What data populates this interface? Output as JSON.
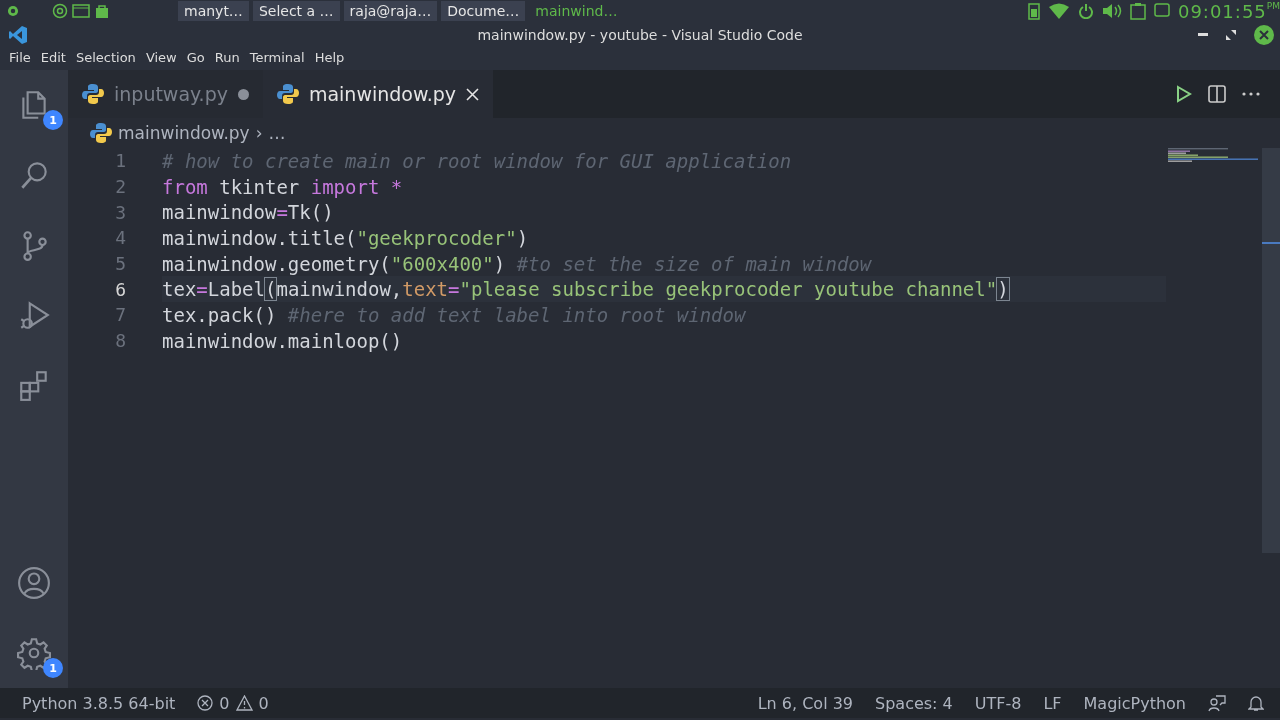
{
  "system_panel": {
    "tasks": [
      {
        "label": "manyt…",
        "selected": false
      },
      {
        "label": "Select a …",
        "selected": false
      },
      {
        "label": "raja@raja…",
        "selected": false
      },
      {
        "label": "Docume…",
        "selected": false
      },
      {
        "label": "mainwind…",
        "selected": true
      }
    ],
    "clock": "09:01:55",
    "clock_suffix": "PM"
  },
  "window": {
    "title": "mainwindow.py - youtube - Visual Studio Code"
  },
  "menu": [
    "File",
    "Edit",
    "Selection",
    "View",
    "Go",
    "Run",
    "Terminal",
    "Help"
  ],
  "activity_bar": [
    {
      "kind": "files",
      "badge": "1",
      "selected": false
    },
    {
      "kind": "search",
      "selected": false
    },
    {
      "kind": "branch",
      "selected": false
    },
    {
      "kind": "debug",
      "selected": false
    },
    {
      "kind": "extensions",
      "selected": false
    }
  ],
  "activity_bottom": [
    {
      "kind": "account"
    },
    {
      "kind": "settings",
      "badge": "1"
    }
  ],
  "tabs": [
    {
      "label": "inputway.py",
      "selected": false,
      "modified": true
    },
    {
      "label": "mainwindow.py",
      "selected": true,
      "modified": false
    }
  ],
  "breadcrumb": {
    "file": "mainwindow.py",
    "separator": "›",
    "rest": "…"
  },
  "code": [
    {
      "number": "1",
      "current": false,
      "tokens": [
        {
          "kind": "comment",
          "text": "# how to create main or root window for GUI application"
        }
      ]
    },
    {
      "number": "2",
      "current": false,
      "tokens": [
        {
          "kind": "keyword",
          "text": "from"
        },
        {
          "kind": "plain",
          "text": " tkinter "
        },
        {
          "kind": "keyword",
          "text": "import"
        },
        {
          "kind": "operator",
          "text": " *"
        }
      ]
    },
    {
      "number": "3",
      "current": false,
      "tokens": [
        {
          "kind": "plain",
          "text": "mainwindow"
        },
        {
          "kind": "operator",
          "text": "="
        },
        {
          "kind": "plain",
          "text": "Tk()"
        }
      ]
    },
    {
      "number": "4",
      "current": false,
      "tokens": [
        {
          "kind": "plain",
          "text": "mainwindow.title("
        },
        {
          "kind": "string",
          "text": "\"geekprocoder\""
        },
        {
          "kind": "plain",
          "text": ")"
        }
      ]
    },
    {
      "number": "5",
      "current": false,
      "tokens": [
        {
          "kind": "plain",
          "text": "mainwindow.geometry("
        },
        {
          "kind": "string",
          "text": "\"600x400\""
        },
        {
          "kind": "plain",
          "text": ") "
        },
        {
          "kind": "comment",
          "text": "#to set the size of main window"
        }
      ]
    },
    {
      "number": "6",
      "current": true,
      "tokens": [
        {
          "kind": "plain",
          "text": "tex"
        },
        {
          "kind": "operator",
          "text": "="
        },
        {
          "kind": "plain",
          "text": "Label"
        },
        {
          "kind": "bracket",
          "text": "("
        },
        {
          "kind": "plain",
          "text": "mainwindow,"
        },
        {
          "kind": "parameter",
          "text": "text"
        },
        {
          "kind": "operator",
          "text": "="
        },
        {
          "kind": "string",
          "text": "\"please subscribe geekprocoder youtube channel\""
        },
        {
          "kind": "bracket",
          "text": ")"
        }
      ]
    },
    {
      "number": "7",
      "current": false,
      "tokens": [
        {
          "kind": "plain",
          "text": "tex.pack() "
        },
        {
          "kind": "comment",
          "text": "#here to add text label into root window"
        }
      ]
    },
    {
      "number": "8",
      "current": false,
      "tokens": [
        {
          "kind": "plain",
          "text": "mainwindow.mainloop()"
        }
      ]
    }
  ],
  "status_bar": {
    "interpreter": "Python 3.8.5 64-bit",
    "errors": "0",
    "warnings": "0",
    "position": "Ln 6, Col 39",
    "indent": "Spaces: 4",
    "encoding": "UTF-8",
    "eol": "LF",
    "language": "MagicPython"
  }
}
